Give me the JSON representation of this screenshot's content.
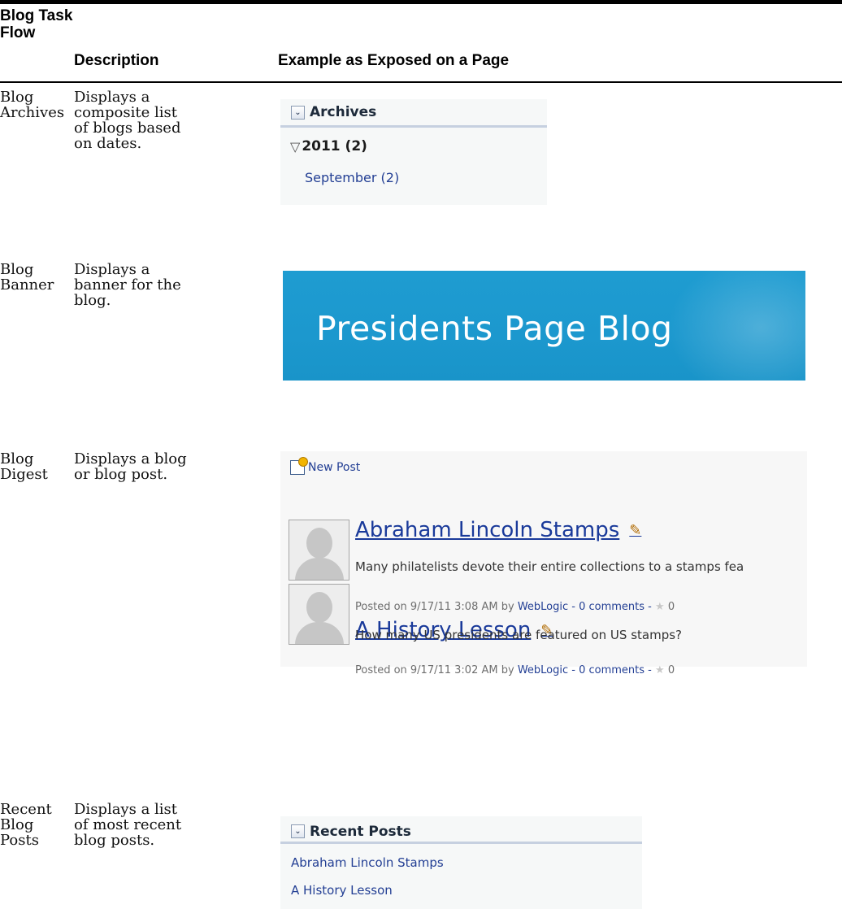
{
  "table": {
    "headers": {
      "col1": "Blog Task Flow",
      "col2": "Description",
      "col3": "Example as Exposed on a Page"
    },
    "rows": [
      {
        "task_flow": "Blog Archives",
        "description": "Displays a composite list of blogs based on dates."
      },
      {
        "task_flow": "Blog Banner",
        "description": "Displays a banner for the blog."
      },
      {
        "task_flow": "Blog Digest",
        "description": "Displays a blog or blog post."
      },
      {
        "task_flow": "Recent Blog Posts",
        "description": "Displays a list of most recent blog posts."
      }
    ]
  },
  "archives_widget": {
    "title": "Archives",
    "collapse_icon": "chevron-down-icon",
    "year_label": "2011 (2)",
    "month_link": "September (2)"
  },
  "banner": {
    "title": "Presidents Page Blog",
    "color": "#1e9cd1"
  },
  "digest": {
    "new_post_label": "New Post",
    "posts": [
      {
        "title": "Abraham Lincoln Stamps",
        "excerpt": "Many philatelists devote their entire collections to a stamps fea",
        "posted_prefix": "Posted on 9/17/11 3:08 AM by",
        "author": "WebLogic",
        "comments": "- 0 comments -",
        "rating": "0"
      },
      {
        "title": "A History Lesson",
        "excerpt": "How many US presidents are featured on US stamps?",
        "posted_prefix": "Posted on 9/17/11 3:02 AM by",
        "author": "WebLogic",
        "comments": "- 0 comments -",
        "rating": "0"
      }
    ]
  },
  "recent_widget": {
    "title": "Recent Posts",
    "items": [
      "Abraham Lincoln Stamps",
      "A History Lesson"
    ]
  },
  "colors": {
    "link": "#233f94",
    "widget_rule": "#c6d0e0"
  }
}
